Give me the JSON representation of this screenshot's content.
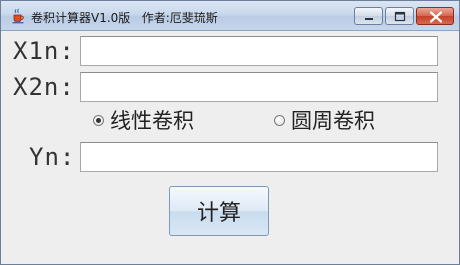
{
  "window": {
    "title": "卷积计算器V1.0版   作者:厄斐琉斯"
  },
  "form": {
    "x1_label": "X1n:",
    "x1_value": "",
    "x2_label": "X2n:",
    "x2_value": "",
    "yn_label": "Yn:",
    "yn_value": ""
  },
  "options": {
    "linear_label": "线性卷积",
    "linear_checked": true,
    "circular_label": "圆周卷积",
    "circular_checked": false
  },
  "actions": {
    "calculate_label": "计算"
  },
  "icons": {
    "app": "java-cup-icon",
    "minimize": "minimize-icon",
    "maximize": "maximize-icon",
    "close": "close-icon"
  }
}
